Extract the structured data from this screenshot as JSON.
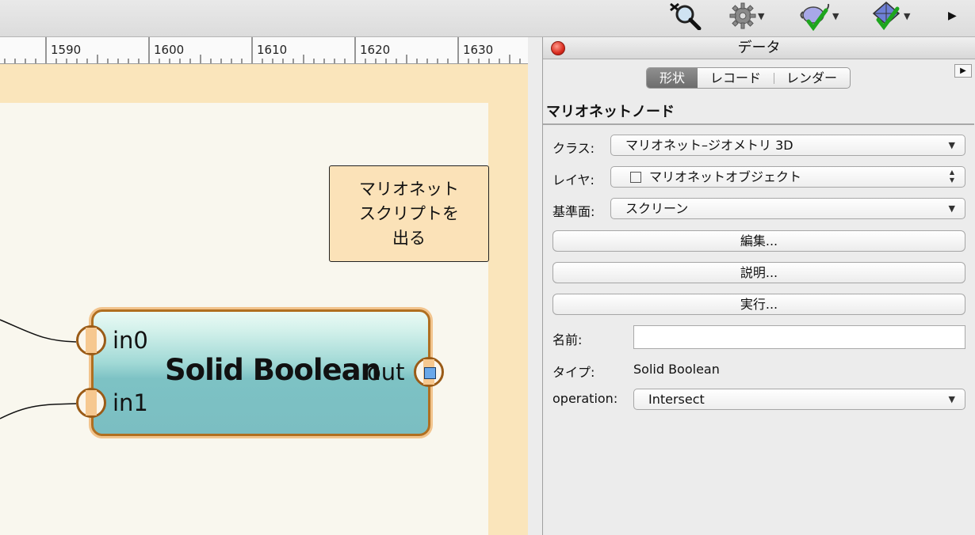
{
  "toolbar": {
    "icons": [
      "search-icon",
      "gear-icon",
      "teapot-check-icon",
      "geometry-check-icon",
      "more-arrow-icon"
    ],
    "dropdown_arrow": "▼",
    "more_arrow": "▶"
  },
  "ruler": {
    "labels": [
      "1590",
      "1600",
      "1610",
      "1620",
      "1630"
    ]
  },
  "canvas": {
    "exit_box_text": "マリオネット スクリプトを 出る",
    "node": {
      "title": "Solid Boolean",
      "in0": "in0",
      "in1": "in1",
      "out": "out"
    }
  },
  "panel": {
    "title": "データ",
    "tabs": [
      "形状",
      "レコード",
      "レンダー"
    ],
    "side_arrow": "▶",
    "heading": "マリオネットノード",
    "class_label": "クラス:",
    "class_value": "マリオネット–ジオメトリ 3D",
    "layer_label": "レイヤ:",
    "layer_value": "マリオネットオブジェクト",
    "plane_label": "基準面:",
    "plane_value": "スクリーン",
    "edit_button": "編集...",
    "description_button": "説明...",
    "run_button": "実行...",
    "name_label": "名前:",
    "name_value": "",
    "type_label": "タイプ:",
    "type_value": "Solid Boolean",
    "operation_label": "operation:",
    "operation_value": "Intersect",
    "caret": "▼",
    "updown_up": "▲",
    "updown_down": "▼"
  },
  "colors": {
    "canvas_margin": "#fae5bb",
    "page": "#f9f7ee",
    "node_border": "#b06f20",
    "node_fill": "#7bbec2",
    "close_button": "#d92c1f"
  }
}
